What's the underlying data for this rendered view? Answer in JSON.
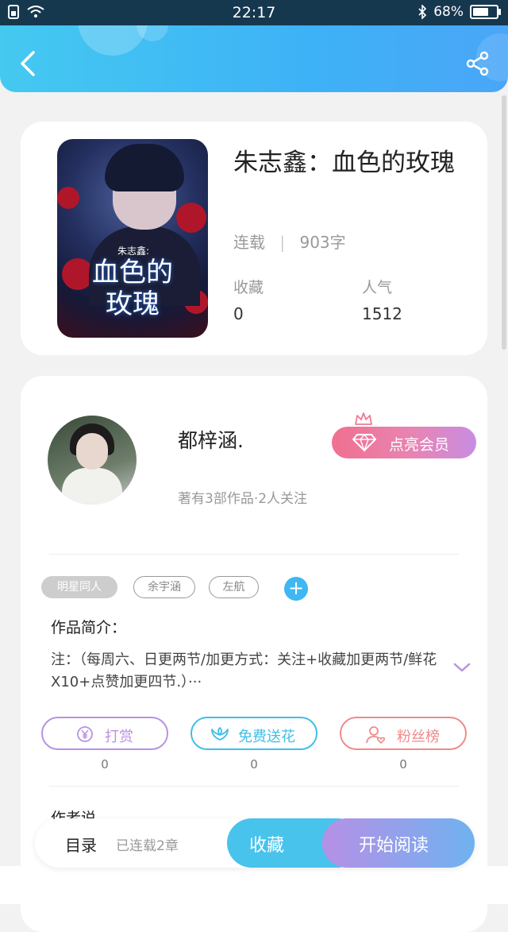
{
  "status_bar": {
    "time": "22:17",
    "battery": "68%",
    "battery_level": 0.68
  },
  "book": {
    "title": "朱志鑫：血色的玫瑰",
    "status": "连载",
    "word_count": "903字",
    "favorites_label": "收藏",
    "favorites_value": "0",
    "popularity_label": "人气",
    "popularity_value": "1512",
    "cover_subtitle": "朱志鑫:",
    "cover_title_line1": "血色的",
    "cover_title_line2": "玫瑰"
  },
  "author": {
    "name": "都梓涵.",
    "stats": "著有3部作品·2人关注",
    "vip_button": "点亮会员"
  },
  "tags": [
    "明星同人",
    "余宇涵",
    "左航"
  ],
  "intro": {
    "title": "作品简介：",
    "text": "注：（每周六、日更两节/加更方式：关注+收藏加更两节/鲜花X10+点赞加更四节.）···"
  },
  "actions": [
    {
      "label": "打赏",
      "count": "0",
      "color": "#b892e3"
    },
    {
      "label": "免费送花",
      "count": "0",
      "color": "#3fbfe8"
    },
    {
      "label": "粉丝榜",
      "count": "0",
      "color": "#f08a8a"
    }
  ],
  "author_says_partial": "作者说",
  "bottom_bar": {
    "toc_label": "目录",
    "toc_status": "已连载2章",
    "favorite_button": "收藏",
    "read_button": "开始阅读"
  }
}
